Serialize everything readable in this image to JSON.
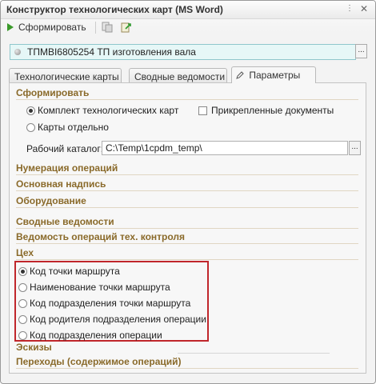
{
  "window": {
    "title": "Конструктор технологических карт (MS Word)"
  },
  "toolbar": {
    "form_label": "Сформировать"
  },
  "object": {
    "value": "ТПМВI6805254 ТП изготовления вала",
    "select_btn": "..."
  },
  "tabs": [
    {
      "label": "Технологические карты"
    },
    {
      "label": "Сводные ведомости"
    },
    {
      "label": "Параметры",
      "active": true
    }
  ],
  "params": {
    "form_section": "Сформировать",
    "opt_set": "Комплект технологических карт",
    "opt_separate": "Карты отдельно",
    "attached_docs": "Прикрепленные документы",
    "workdir_label": "Рабочий каталог:",
    "workdir_value": "C:\\Temp\\1cpdm_temp\\",
    "workdir_btn": "...",
    "sections": {
      "numbering": "Нумерация операций",
      "main_label": "Основная надпись",
      "equipment": "Оборудование",
      "summary": "Сводные ведомости",
      "control": "Ведомость операций тех. контроля",
      "shop": "Цех",
      "sketches": "Эскизы",
      "transitions": "Переходы (содержимое операций)"
    },
    "shop_options": [
      {
        "label": "Код точки маршрута",
        "selected": true
      },
      {
        "label": "Наименование точки маршрута",
        "selected": false
      },
      {
        "label": "Код подразделения точки маршрута",
        "selected": false
      },
      {
        "label": "Код родителя подразделения операции",
        "selected": false
      },
      {
        "label": "Код подразделения операции",
        "selected": false
      }
    ]
  },
  "colors": {
    "section": "#8a6a2a",
    "highlight": "#c0262b",
    "selector": "#e6f7f7"
  }
}
